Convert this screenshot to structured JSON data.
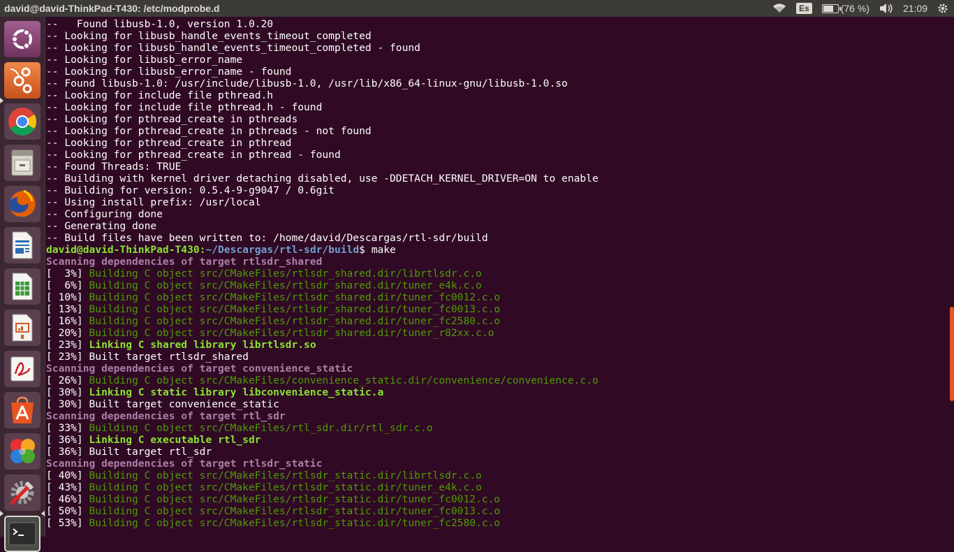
{
  "window": {
    "title": "david@david-ThinkPad-T430: /etc/modprobe.d"
  },
  "indicators": {
    "keyboard": "Es",
    "battery_text": "(76 %)",
    "battery_percent": 76,
    "clock": "21:09",
    "icons": [
      "wifi-icon",
      "keyboard-layout-icon",
      "battery-icon",
      "volume-icon",
      "gear-icon"
    ]
  },
  "launcher": {
    "items": [
      {
        "name": "ubuntu-dash-icon"
      },
      {
        "name": "synaptic-orange-icon"
      },
      {
        "name": "chrome-icon"
      },
      {
        "name": "file-cabinet-icon"
      },
      {
        "name": "firefox-icon"
      },
      {
        "name": "writer-icon"
      },
      {
        "name": "calc-icon"
      },
      {
        "name": "impress-icon"
      },
      {
        "name": "pdf-viewer-icon"
      },
      {
        "name": "software-center-icon"
      },
      {
        "name": "solitaire-icon"
      },
      {
        "name": "system-settings-icon"
      },
      {
        "name": "terminal-icon"
      }
    ]
  },
  "terminal": {
    "prompt": {
      "user": "david@david-ThinkPad-T430",
      "path": "~/Descargas/rtl-sdr/build",
      "command": "make"
    },
    "lines": [
      {
        "t": "--   Found libusb-1.0, version 1.0.20"
      },
      {
        "t": "-- Looking for libusb_handle_events_timeout_completed"
      },
      {
        "t": "-- Looking for libusb_handle_events_timeout_completed - found"
      },
      {
        "t": "-- Looking for libusb_error_name"
      },
      {
        "t": "-- Looking for libusb_error_name - found"
      },
      {
        "t": "-- Found libusb-1.0: /usr/include/libusb-1.0, /usr/lib/x86_64-linux-gnu/libusb-1.0.so"
      },
      {
        "t": "-- Looking for include file pthread.h"
      },
      {
        "t": "-- Looking for include file pthread.h - found"
      },
      {
        "t": "-- Looking for pthread_create in pthreads"
      },
      {
        "t": "-- Looking for pthread_create in pthreads - not found"
      },
      {
        "t": "-- Looking for pthread_create in pthread"
      },
      {
        "t": "-- Looking for pthread_create in pthread - found"
      },
      {
        "t": "-- Found Threads: TRUE"
      },
      {
        "t": "-- Building with kernel driver detaching disabled, use -DDETACH_KERNEL_DRIVER=ON to enable"
      },
      {
        "t": "-- Building for version: 0.5.4-9-g9047 / 0.6git"
      },
      {
        "t": "-- Using install prefix: /usr/local"
      },
      {
        "t": "-- Configuring done"
      },
      {
        "t": "-- Generating done"
      },
      {
        "t": "-- Build files have been written to: /home/david/Descargas/rtl-sdr/build"
      },
      {
        "type": "prompt"
      },
      {
        "type": "scan",
        "t": "Scanning dependencies of target rtlsdr_shared"
      },
      {
        "type": "build",
        "p": "[  3%] ",
        "t": "Building C object src/CMakeFiles/rtlsdr_shared.dir/librtlsdr.c.o"
      },
      {
        "type": "build",
        "p": "[  6%] ",
        "t": "Building C object src/CMakeFiles/rtlsdr_shared.dir/tuner_e4k.c.o"
      },
      {
        "type": "build",
        "p": "[ 10%] ",
        "t": "Building C object src/CMakeFiles/rtlsdr_shared.dir/tuner_fc0012.c.o"
      },
      {
        "type": "build",
        "p": "[ 13%] ",
        "t": "Building C object src/CMakeFiles/rtlsdr_shared.dir/tuner_fc0013.c.o"
      },
      {
        "type": "build",
        "p": "[ 16%] ",
        "t": "Building C object src/CMakeFiles/rtlsdr_shared.dir/tuner_fc2580.c.o"
      },
      {
        "type": "build",
        "p": "[ 20%] ",
        "t": "Building C object src/CMakeFiles/rtlsdr_shared.dir/tuner_r82xx.c.o"
      },
      {
        "type": "link",
        "p": "[ 23%] ",
        "t": "Linking C shared library librtlsdr.so"
      },
      {
        "t": "[ 23%] Built target rtlsdr_shared"
      },
      {
        "type": "scan",
        "t": "Scanning dependencies of target convenience_static"
      },
      {
        "type": "build",
        "p": "[ 26%] ",
        "t": "Building C object src/CMakeFiles/convenience_static.dir/convenience/convenience.c.o"
      },
      {
        "type": "link",
        "p": "[ 30%] ",
        "t": "Linking C static library libconvenience_static.a"
      },
      {
        "t": "[ 30%] Built target convenience_static"
      },
      {
        "type": "scan",
        "t": "Scanning dependencies of target rtl_sdr"
      },
      {
        "type": "build",
        "p": "[ 33%] ",
        "t": "Building C object src/CMakeFiles/rtl_sdr.dir/rtl_sdr.c.o"
      },
      {
        "type": "link",
        "p": "[ 36%] ",
        "t": "Linking C executable rtl_sdr"
      },
      {
        "t": "[ 36%] Built target rtl_sdr"
      },
      {
        "type": "scan",
        "t": "Scanning dependencies of target rtlsdr_static"
      },
      {
        "type": "build",
        "p": "[ 40%] ",
        "t": "Building C object src/CMakeFiles/rtlsdr_static.dir/librtlsdr.c.o"
      },
      {
        "type": "build",
        "p": "[ 43%] ",
        "t": "Building C object src/CMakeFiles/rtlsdr_static.dir/tuner_e4k.c.o"
      },
      {
        "type": "build",
        "p": "[ 46%] ",
        "t": "Building C object src/CMakeFiles/rtlsdr_static.dir/tuner_fc0012.c.o"
      },
      {
        "type": "build",
        "p": "[ 50%] ",
        "t": "Building C object src/CMakeFiles/rtlsdr_static.dir/tuner_fc0013.c.o"
      },
      {
        "type": "build",
        "p": "[ 53%] ",
        "t": "Building C object src/CMakeFiles/rtlsdr_static.dir/tuner_fc2580.c.o"
      }
    ]
  },
  "colors": {
    "terminal_bg": "#300a24",
    "panel_bg": "#3c3b37",
    "launcher_bg": "#3b2731",
    "accent": "#e95420",
    "build_green": "#4e9a06",
    "link_green": "#8ae234",
    "scan_purple": "#ad7fa8",
    "path_blue": "#729fcf"
  }
}
